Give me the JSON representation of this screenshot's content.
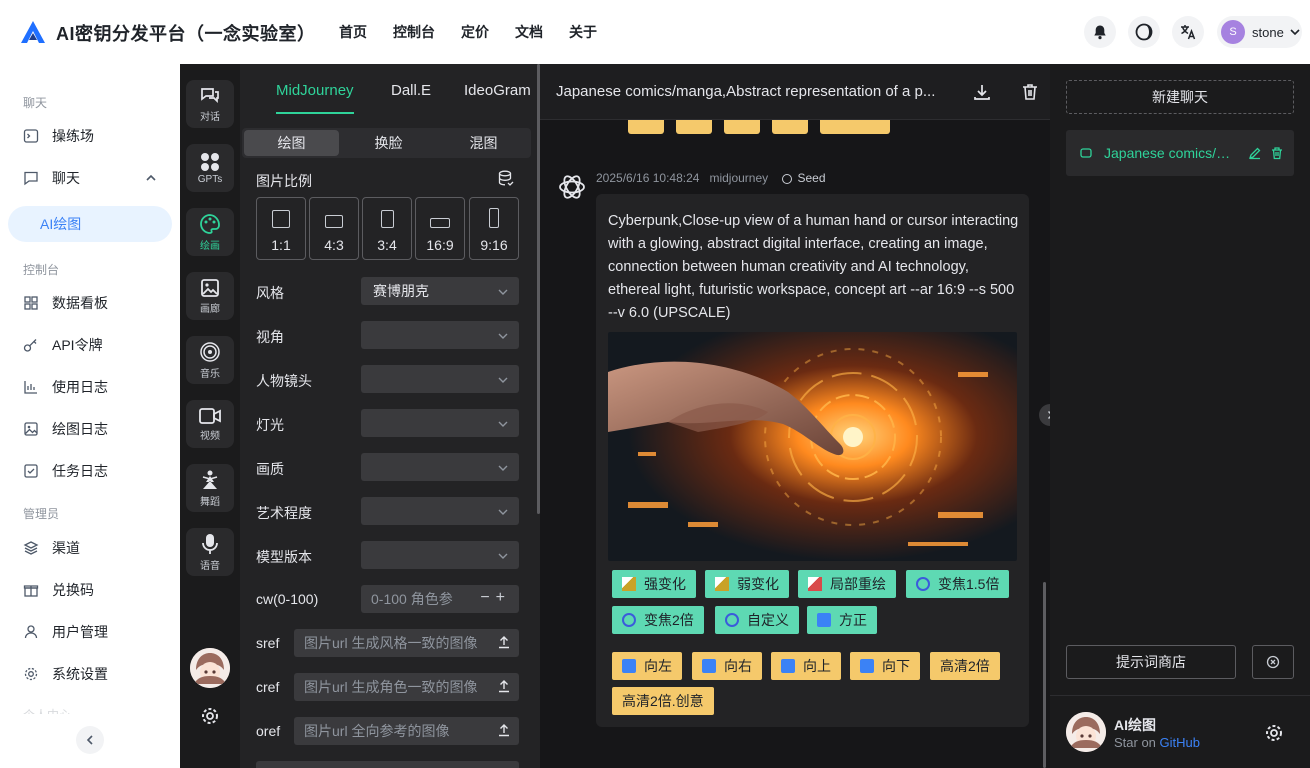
{
  "header": {
    "title": "AI密钥分发平台（一念实验室）",
    "nav": [
      "首页",
      "控制台",
      "定价",
      "文档",
      "关于"
    ],
    "user": {
      "initial": "S",
      "name": "stone"
    },
    "colors": {
      "brand": "#1f6fff",
      "avatar": "#a682e0"
    }
  },
  "sidebar": {
    "sections": {
      "chat": "聊天",
      "console": "控制台",
      "admin": "管理员",
      "personal": "个人中心"
    },
    "items": {
      "playground": "操练场",
      "chat": "聊天",
      "ai_drawing": "AI绘图",
      "dashboard": "数据看板",
      "api_token": "API令牌",
      "usage_log": "使用日志",
      "draw_log": "绘图日志",
      "task_log": "任务日志",
      "channel": "渠道",
      "redeem": "兑换码",
      "user_mgmt": "用户管理",
      "settings": "系统设置"
    }
  },
  "rail": {
    "items": [
      "对话",
      "GPTs",
      "绘画",
      "画廊",
      "音乐",
      "视频",
      "舞蹈",
      "语音"
    ],
    "active_index": 2
  },
  "panel": {
    "tabs": [
      "MidJourney",
      "Dall.E",
      "IdeoGram"
    ],
    "modes": [
      "绘图",
      "换脸",
      "混图"
    ],
    "ratio_label": "图片比例",
    "ratios": [
      "1:1",
      "4:3",
      "3:4",
      "16:9",
      "9:16"
    ],
    "style_label": "风格",
    "style_value": "赛博朋克",
    "view_label": "视角",
    "lens_label": "人物镜头",
    "light_label": "灯光",
    "quality_label": "画质",
    "art_label": "艺术程度",
    "version_label": "模型版本",
    "cw_label": "cw(0-100)",
    "cw_placeholder": "0-100 角色参",
    "sref_label": "sref",
    "sref_placeholder": "图片url 生成风格一致的图像",
    "cref_label": "cref",
    "cref_placeholder": "图片url 生成角色一致的图像",
    "oref_label": "oref",
    "oref_placeholder": "图片url 全向参考的图像"
  },
  "chat": {
    "title": "Japanese comics/manga,Abstract representation of a p...",
    "message": {
      "timestamp": "2025/6/16 10:48:24",
      "model": "midjourney",
      "seed_label": "Seed",
      "prompt": "Cyberpunk,Close-up view of a human hand or cursor interacting with a glowing, abstract digital interface, creating an image, connection between human creativity and AI technology, ethereal light, futuristic workspace, concept art --ar 16:9 --s 500 --v 6.0 (UPSCALE)"
    },
    "green_actions": [
      "强变化",
      "弱变化",
      "局部重绘",
      "变焦1.5倍",
      "变焦2倍",
      "自定义",
      "方正"
    ],
    "yellow_actions": [
      "向左",
      "向右",
      "向上",
      "向下",
      "高清2倍",
      "高清2倍.创意"
    ]
  },
  "right": {
    "new_chat": "新建聊天",
    "conversation": "Japanese comics/manga,Abstract representation of a p...",
    "prompt_store": "提示词商店",
    "footer_name": "AI绘图",
    "footer_sub": "Star on",
    "footer_link": "GitHub"
  }
}
